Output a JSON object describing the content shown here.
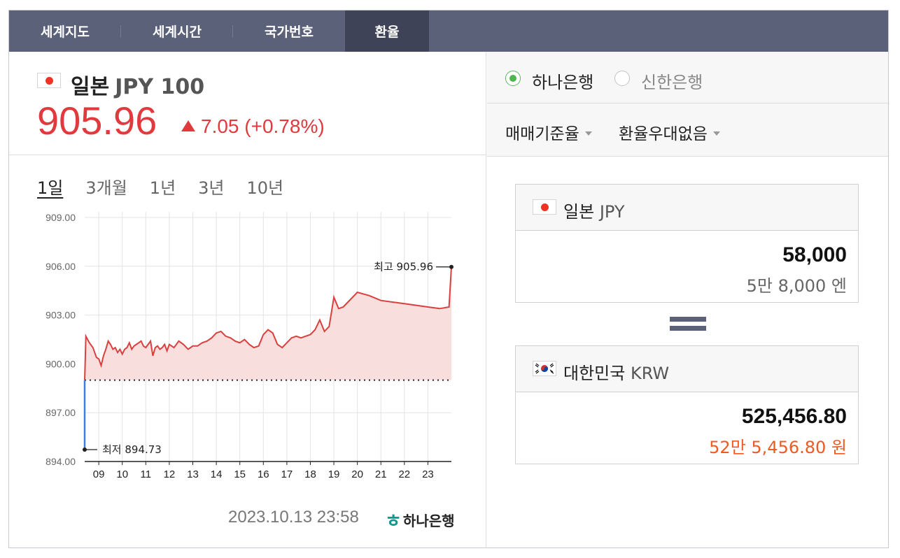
{
  "tabs": [
    {
      "label": "세계지도"
    },
    {
      "label": "세계시간"
    },
    {
      "label": "국가번호"
    },
    {
      "label": "환율"
    }
  ],
  "rate": {
    "country": "일본",
    "code": "JPY 100",
    "value": "905.96",
    "change": "7.05 (+0.78%)",
    "direction": "up",
    "color": "#e03a3e"
  },
  "periods": [
    {
      "label": "1일",
      "active": true
    },
    {
      "label": "3개월"
    },
    {
      "label": "1년"
    },
    {
      "label": "3년"
    },
    {
      "label": "10년"
    }
  ],
  "chart_data": {
    "type": "area",
    "ylim": [
      894,
      909
    ],
    "y_ticks": [
      "909.00",
      "906.00",
      "903.00",
      "900.00",
      "897.00",
      "894.00"
    ],
    "x_ticks": [
      "09",
      "10",
      "11",
      "12",
      "13",
      "14",
      "15",
      "16",
      "17",
      "18",
      "19",
      "20",
      "21",
      "22",
      "23"
    ],
    "baseline": 899.0,
    "high_label": "최고 905.96",
    "low_label": "최저 894.73",
    "high": 905.96,
    "low": 894.73,
    "series": [
      {
        "x": [
          8.4,
          8.45,
          8.6,
          8.75,
          8.9,
          9.0,
          9.1,
          9.2,
          9.3,
          9.4,
          9.5,
          9.6,
          9.7,
          9.8,
          9.9,
          10.0,
          10.1,
          10.2,
          10.3,
          10.4,
          10.5,
          10.6,
          10.7,
          10.8,
          10.9,
          11.0,
          11.1,
          11.2,
          11.3,
          11.4,
          11.5,
          11.6,
          11.7,
          11.8,
          11.9,
          12.0,
          12.2,
          12.4,
          12.6,
          12.8,
          13.0,
          13.2,
          13.4,
          13.6,
          13.8,
          14.0,
          14.2,
          14.4,
          14.6,
          14.8,
          15.0,
          15.2,
          15.4,
          15.6,
          15.8,
          16.0,
          16.2,
          16.4,
          16.6,
          16.8,
          17.0,
          17.2,
          17.4,
          17.6,
          17.8,
          18.0,
          18.2,
          18.4,
          18.6,
          18.8,
          19.0,
          19.2,
          19.4,
          19.6,
          19.8,
          20.0,
          20.5,
          21.0,
          21.5,
          22.0,
          22.5,
          23.0,
          23.5,
          23.9,
          24.0
        ],
        "values": [
          899.0,
          901.7,
          901.3,
          901.0,
          900.4,
          900.3,
          899.9,
          900.5,
          900.9,
          901.4,
          901.2,
          900.9,
          901.0,
          900.7,
          900.9,
          900.6,
          900.9,
          901.0,
          901.3,
          900.9,
          901.1,
          901.2,
          901.3,
          901.4,
          901.1,
          901.0,
          901.2,
          901.4,
          900.5,
          901.0,
          901.1,
          900.9,
          901.0,
          901.2,
          900.8,
          901.2,
          901.0,
          901.4,
          901.2,
          900.9,
          901.1,
          901.1,
          901.3,
          901.4,
          901.6,
          901.9,
          902.0,
          901.7,
          901.6,
          901.4,
          901.3,
          901.5,
          901.2,
          901.0,
          901.1,
          901.8,
          902.1,
          901.9,
          901.2,
          901.0,
          901.3,
          901.6,
          901.7,
          901.6,
          901.7,
          901.8,
          902.1,
          902.7,
          902.0,
          902.3,
          904.1,
          903.4,
          903.5,
          903.8,
          904.1,
          904.4,
          904.2,
          903.9,
          903.8,
          903.7,
          903.6,
          903.5,
          903.4,
          903.5,
          905.96
        ]
      }
    ]
  },
  "footer": {
    "datetime": "2023.10.13 23:58",
    "bank_logo_text": "하나은행"
  },
  "banks": [
    {
      "label": "하나은행",
      "checked": true
    },
    {
      "label": "신한은행",
      "checked": false
    }
  ],
  "options": {
    "rate_type": "매매기준율",
    "discount": "환율우대없음"
  },
  "from": {
    "country": "일본",
    "code": "JPY",
    "amount": "58,000",
    "amount_korean": "5만 8,000 엔"
  },
  "to": {
    "country": "대한민국",
    "code": "KRW",
    "amount": "525,456.80",
    "amount_korean": "52만 5,456.80 원"
  }
}
